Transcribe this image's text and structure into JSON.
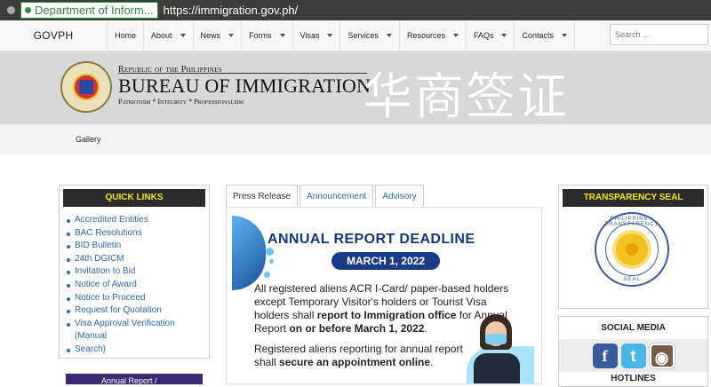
{
  "browser": {
    "tab_title": "Department of Inform...",
    "url": "https://immigration.gov.ph/"
  },
  "nav": {
    "brand": "GOVPH",
    "items": [
      {
        "label": "Home",
        "dropdown": false
      },
      {
        "label": "About",
        "dropdown": true
      },
      {
        "label": "News",
        "dropdown": true
      },
      {
        "label": "Forms",
        "dropdown": true
      },
      {
        "label": "Visas",
        "dropdown": true
      },
      {
        "label": "Services",
        "dropdown": true
      },
      {
        "label": "Resources",
        "dropdown": true
      },
      {
        "label": "FAQs",
        "dropdown": true
      },
      {
        "label": "Contacts",
        "dropdown": true
      }
    ],
    "search_placeholder": "Search ..."
  },
  "banner": {
    "republic": "Republic of the Philippines",
    "bureau": "BUREAU OF IMMIGRATION",
    "tagline": "Patriotism * Integrity * Professionalism",
    "watermark": "华商签证"
  },
  "subnav": {
    "gallery": "Gallery"
  },
  "quick_links": {
    "title": "QUICK LINKS",
    "items": [
      "Accredited Entities",
      "BAC Resolutions",
      "BID Bulletin",
      "24th DGICM",
      "Invitation to Bid",
      "Notice of Award",
      "Notice to Proceed",
      "Request for Quotation",
      "Visa Approval Verification (Manual",
      "Search)"
    ],
    "bottom_banner": "Annual Report /"
  },
  "tabs": [
    "Press Release",
    "Announcement",
    "Advisory"
  ],
  "content": {
    "title": "ANNUAL REPORT DEADLINE",
    "date": "MARCH 1, 2022",
    "para1_a": "All registered aliens ACR I-Card/ paper-based holders except Temporary Visitor's holders or Tourist Visa holders shall ",
    "para1_b": "report to Immigration office",
    "para1_c": " for Annual Report ",
    "para1_d": "on or before March 1, 2022",
    "para1_e": ".",
    "para2_a": "Registered aliens reporting for annual report shall ",
    "para2_b": "secure an appointment online",
    "para2_c": "."
  },
  "transparency": {
    "title": "TRANSPARENCY SEAL",
    "seal_top": "PHILIPPINE • TRANSPARENCY",
    "seal_bottom": "SEAL"
  },
  "social": {
    "title": "SOCIAL MEDIA",
    "hotlines": "HOTLINES",
    "icons": [
      "facebook-icon",
      "twitter-icon",
      "instagram-icon"
    ]
  }
}
